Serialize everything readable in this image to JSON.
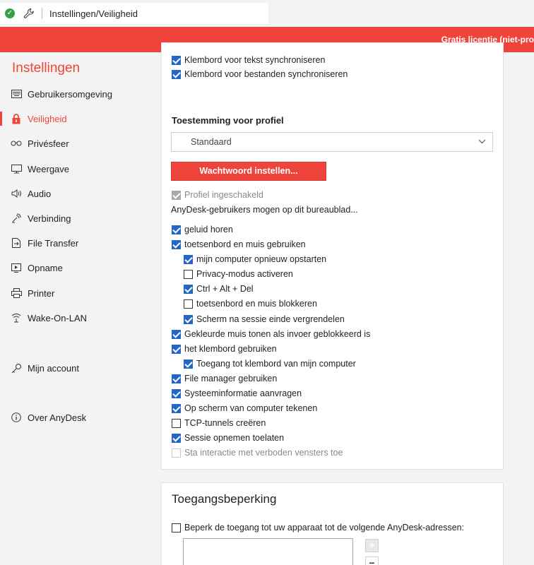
{
  "window": {
    "tab_title": "Instellingen/Veiligheid",
    "license_text": "Gratis licentie (niet-pro"
  },
  "sidebar": {
    "heading": "Instellingen",
    "items": [
      {
        "label": "Gebruikersomgeving",
        "icon": "keyboard-icon"
      },
      {
        "label": "Veiligheid",
        "icon": "lock-icon",
        "active": true
      },
      {
        "label": "Privésfeer",
        "icon": "glasses-icon"
      },
      {
        "label": "Weergave",
        "icon": "monitor-icon"
      },
      {
        "label": "Audio",
        "icon": "speaker-icon"
      },
      {
        "label": "Verbinding",
        "icon": "connection-icon"
      },
      {
        "label": "File Transfer",
        "icon": "file-icon"
      },
      {
        "label": "Opname",
        "icon": "recording-icon"
      },
      {
        "label": "Printer",
        "icon": "printer-icon"
      },
      {
        "label": "Wake-On-LAN",
        "icon": "wifi-icon"
      },
      {
        "label": "Mijn account",
        "icon": "key-icon"
      },
      {
        "label": "Over AnyDesk",
        "icon": "info-icon"
      }
    ]
  },
  "clipboard": {
    "sync_text": "Klembord voor tekst synchroniseren",
    "sync_files": "Klembord voor bestanden synchroniseren"
  },
  "profile": {
    "section_title": "Toestemming voor profiel",
    "select_value": "Standaard",
    "set_password_button": "Wachtwoord instellen...",
    "profile_enabled": "Profiel ingeschakeld",
    "users_may": "AnyDesk-gebruikers mogen op dit bureaublad...",
    "permissions": [
      {
        "label": "geluid horen",
        "checked": true
      },
      {
        "label": "toetsenbord en muis gebruiken",
        "checked": true
      },
      {
        "label": "mijn computer opnieuw opstarten",
        "checked": true
      },
      {
        "label": "Privacy-modus activeren",
        "checked": false
      },
      {
        "label": "Ctrl + Alt + Del",
        "checked": true
      },
      {
        "label": "toetsenbord en muis blokkeren",
        "checked": false
      },
      {
        "label": "Scherm na sessie einde vergrendelen",
        "checked": true
      },
      {
        "label": "Gekleurde muis tonen als invoer geblokkeerd is",
        "checked": true
      },
      {
        "label": "het klembord gebruiken",
        "checked": true
      },
      {
        "label": "Toegang tot klembord van mijn computer",
        "checked": true
      },
      {
        "label": "File manager gebruiken",
        "checked": true
      },
      {
        "label": "Systeeminformatie aanvragen",
        "checked": true
      },
      {
        "label": "Op scherm van computer tekenen",
        "checked": true
      },
      {
        "label": "TCP-tunnels creëren",
        "checked": false
      },
      {
        "label": "Sessie opnemen toelaten",
        "checked": true
      },
      {
        "label": "Sta interactie met verboden vensters toe",
        "checked": false,
        "disabled": true
      }
    ]
  },
  "access": {
    "section_title": "Toegangsbeperking",
    "restrict_label": "Beperk de toegang tot uw apparaat tot de volgende AnyDesk-adressen:",
    "add_button": "+",
    "remove_button": "−"
  },
  "colors": {
    "accent": "#ef443b",
    "checkbox": "#2466c7"
  }
}
